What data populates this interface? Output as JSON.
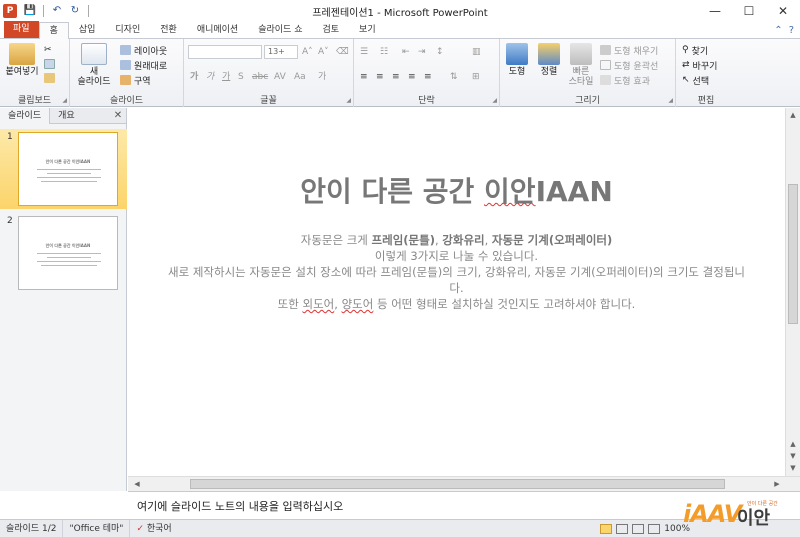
{
  "window": {
    "title": "프레젠테이션1 - Microsoft PowerPoint",
    "minimize": "—",
    "restore": "☐",
    "close": "✕"
  },
  "app_icon": "P",
  "qat": {
    "save": "💾",
    "undo": "↶",
    "redo": "↻"
  },
  "tabs": [
    {
      "label": "파일",
      "kind": "file"
    },
    {
      "label": "홈",
      "kind": "active"
    },
    {
      "label": "삽입",
      "kind": ""
    },
    {
      "label": "디자인",
      "kind": ""
    },
    {
      "label": "전환",
      "kind": ""
    },
    {
      "label": "애니메이션",
      "kind": ""
    },
    {
      "label": "슬라이드 쇼",
      "kind": ""
    },
    {
      "label": "검토",
      "kind": ""
    },
    {
      "label": "보기",
      "kind": ""
    }
  ],
  "ribbon": {
    "clipboard": {
      "label": "클립보드",
      "paste": "붙여넣기"
    },
    "slides": {
      "label": "슬라이드",
      "new_slide_1": "새",
      "new_slide_2": "슬라이드",
      "layout": "레이아웃",
      "reset": "원래대로",
      "section": "구역"
    },
    "font": {
      "label": "글꼴",
      "size": "13+"
    },
    "paragraph": {
      "label": "단락"
    },
    "drawing": {
      "label": "그리기",
      "shapes": "도형",
      "arrange": "정렬",
      "quick_styles_1": "빠른",
      "quick_styles_2": "스타일",
      "fill": "도형 채우기",
      "outline": "도형 윤곽선",
      "effects": "도형 효과"
    },
    "editing": {
      "label": "편집",
      "find": "찾기",
      "replace": "바꾸기",
      "select": "선택"
    }
  },
  "panel": {
    "tab_slides": "슬라이드",
    "tab_outline": "개요",
    "close": "✕",
    "thumbs": [
      {
        "num": "1",
        "title": "안이 다른 공간 이안IAAN"
      },
      {
        "num": "2",
        "title": "안이 다른 공간 이안IAAN"
      }
    ]
  },
  "slide": {
    "title_a": "안이 다른 공간 ",
    "title_b": "이안",
    "title_c": "IAAN",
    "l1_a": "자동문은 크게 ",
    "l1_b": "프레임(문틀)",
    "l1_c": ", ",
    "l1_d": "강화유리",
    "l1_e": ", ",
    "l1_f": "자동문 기계",
    "l1_g": "(오퍼레이터)",
    "l2": "이렇게 3가지로 나눌 수 있습니다.",
    "l3": "새로 제작하시는 자동문은 설치 장소에 따라 프레임(문틀)의 크기,  강화유리, 자동문 기계(오퍼레이터)의 크기도 결정됩니다.",
    "l4_a": "또한 ",
    "l4_b": "외도어",
    "l4_c": ", ",
    "l4_d": "양도어",
    "l4_e": " 등 어떤 형태로 설치하실 것인지도 고려하셔야 합니다."
  },
  "notes": {
    "placeholder": "여기에 슬라이드 노트의 내용을 입력하십시오"
  },
  "logo": {
    "mark": "iAAV",
    "kr": "이안",
    "sub": "안이 다른 공간"
  },
  "status": {
    "slide": "슬라이드 1/2",
    "theme": "\"Office 테마\"",
    "lang": "한국어",
    "zoom": "100%"
  },
  "colors": {
    "file_tab": "#d24726",
    "selection": "#fcd46a",
    "title_text": "#777777",
    "logo_orange": "#f39c2a"
  }
}
